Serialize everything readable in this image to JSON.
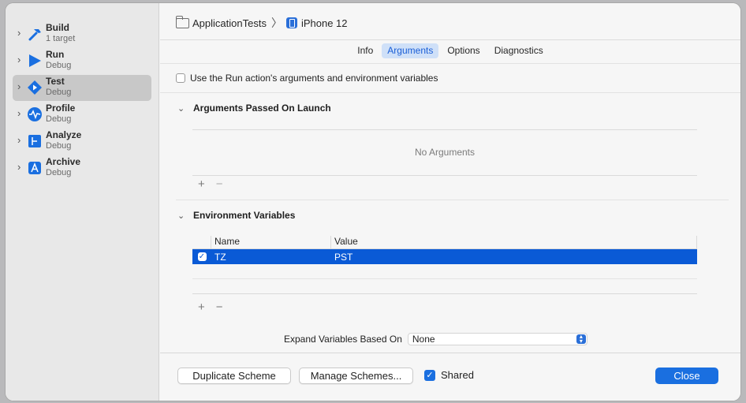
{
  "breadcrumb": {
    "scheme": "ApplicationTests",
    "device": "iPhone 12"
  },
  "actions": [
    {
      "name": "Build",
      "sub": "1 target",
      "icon": "hammer-icon",
      "color": "#1a6fe0"
    },
    {
      "name": "Run",
      "sub": "Debug",
      "icon": "play-icon",
      "color": "#1a6fe0"
    },
    {
      "name": "Test",
      "sub": "Debug",
      "icon": "test-diamond-icon",
      "color": "#1a6fe0",
      "selected": true
    },
    {
      "name": "Profile",
      "sub": "Debug",
      "icon": "waveform-icon",
      "color": "#1a6fe0"
    },
    {
      "name": "Analyze",
      "sub": "Debug",
      "icon": "analyze-icon",
      "color": "#1a6fe0"
    },
    {
      "name": "Archive",
      "sub": "Debug",
      "icon": "archive-icon",
      "color": "#1a6fe0"
    }
  ],
  "tabs": [
    {
      "label": "Info"
    },
    {
      "label": "Arguments",
      "active": true
    },
    {
      "label": "Options"
    },
    {
      "label": "Diagnostics"
    }
  ],
  "use_run_label": "Use the Run action's arguments and environment variables",
  "arguments_section": {
    "title": "Arguments Passed On Launch",
    "empty_text": "No Arguments"
  },
  "env_section": {
    "title": "Environment Variables",
    "columns": {
      "name": "Name",
      "value": "Value"
    },
    "rows": [
      {
        "name": "TZ",
        "value": "PST",
        "enabled": true
      }
    ]
  },
  "controls": {
    "plus": "+",
    "minus": "−"
  },
  "expand": {
    "label": "Expand Variables Based On",
    "value": "None"
  },
  "footer": {
    "duplicate": "Duplicate Scheme",
    "manage": "Manage Schemes...",
    "shared": "Shared",
    "close": "Close"
  },
  "accent_color": "#1a6fe0"
}
